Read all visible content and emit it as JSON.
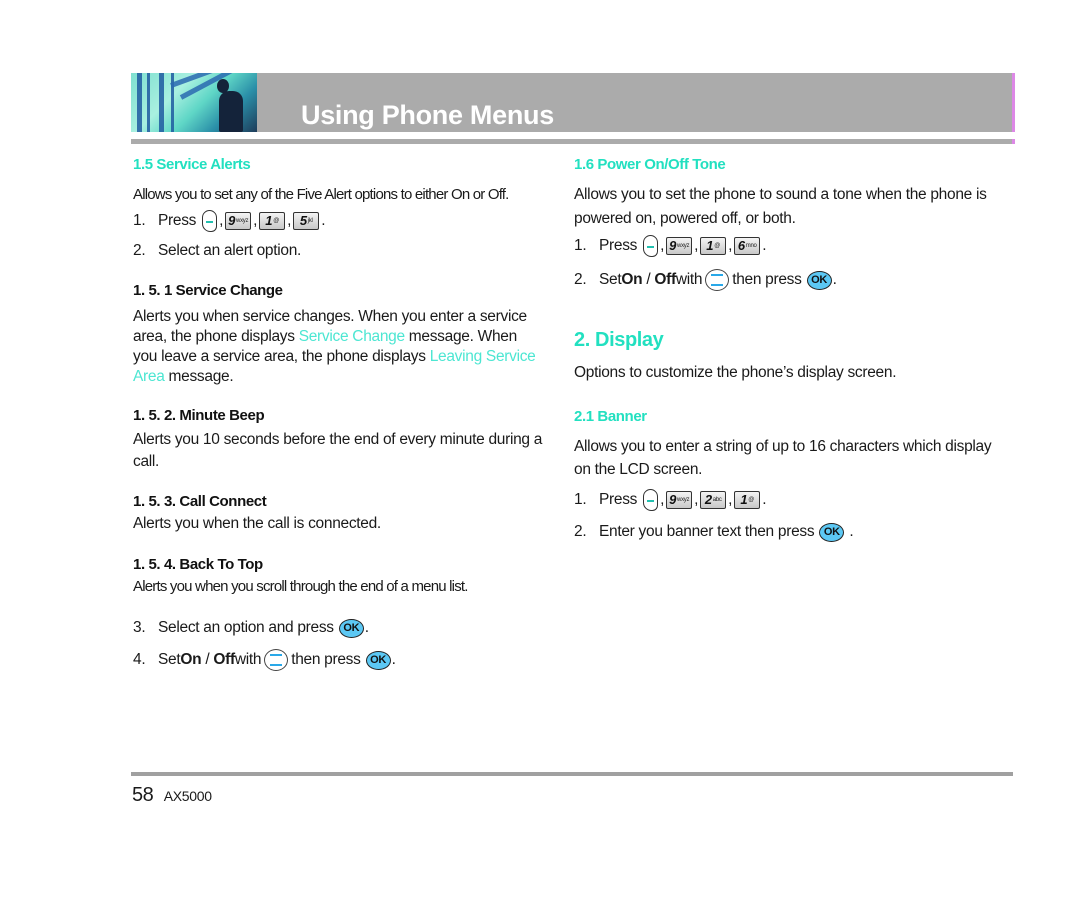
{
  "header": {
    "title": "Using Phone Menus"
  },
  "left": {
    "s15": {
      "heading": "1.5 Service Alerts",
      "intro": "Allows you to set any of the Five Alert options to either On or Off.",
      "step1_num": "1.",
      "step1_text": "Press",
      "step1_keys": [
        {
          "d": "9",
          "s": "wxyz"
        },
        {
          "d": "1",
          "s": "@"
        },
        {
          "d": "5",
          "s": "jkl"
        }
      ],
      "step2_num": "2.",
      "step2_text": "Select an alert option."
    },
    "s151": {
      "heading": "1. 5. 1 Service Change",
      "t1": "Alerts you when service changes. When you enter a service area, the phone displays ",
      "hl1": "Service Change",
      "t2": " message. When you leave a service area, the phone displays ",
      "hl2": "Leaving Service Area",
      "t3": " message."
    },
    "s152": {
      "heading": "1. 5. 2. Minute Beep",
      "text": "Alerts you 10 seconds before the end of every minute during a call."
    },
    "s153": {
      "heading": "1. 5. 3. Call Connect",
      "text": "Alerts you when the call is connected."
    },
    "s154": {
      "heading": "1. 5. 4. Back To Top",
      "text": "Alerts you when you scroll through the end of a menu list."
    },
    "step3_num": "3.",
    "step3_text": "Select an option and press",
    "step4_num": "4.",
    "step4_a": "Set ",
    "step4_on": "On",
    "step4_slash": " / ",
    "step4_off": "Off",
    "step4_with": " with",
    "step4_then": "then press"
  },
  "right": {
    "s16": {
      "heading": "1.6 Power On/Off Tone",
      "intro": "Allows you to set the phone to sound a tone when the phone is powered on, powered off, or both.",
      "step1_num": "1.",
      "step1_text": "Press",
      "step1_keys": [
        {
          "d": "9",
          "s": "wxyz"
        },
        {
          "d": "1",
          "s": "@"
        },
        {
          "d": "6",
          "s": "mno"
        }
      ],
      "step2_num": "2.",
      "step2_a": "Set ",
      "step2_on": "On",
      "step2_slash": " / ",
      "step2_off": "Off",
      "step2_with": " with",
      "step2_then": "then press"
    },
    "s2": {
      "heading": "2. Display",
      "text": "Options to customize the phone’s display screen."
    },
    "s21": {
      "heading": "2.1 Banner",
      "intro": "Allows you to enter a string of up to 16 characters which display on the LCD screen.",
      "step1_num": "1.",
      "step1_text": "Press",
      "step1_keys": [
        {
          "d": "9",
          "s": "wxyz"
        },
        {
          "d": "2",
          "s": "abc"
        },
        {
          "d": "1",
          "s": "@"
        }
      ],
      "step2_num": "2.",
      "step2_text": "Enter you banner text then press"
    }
  },
  "icons": {
    "ok_label": "OK",
    "soft_key": "left-soft-key-icon",
    "nav_key": "nav-updown-icon"
  },
  "footer": {
    "page_number": "58",
    "model": "AX5000"
  },
  "colors": {
    "accent": "#22e0c0",
    "highlight": "#4ce6d2",
    "header_bg": "#ababab",
    "ok_key": "#5cc8f4"
  }
}
